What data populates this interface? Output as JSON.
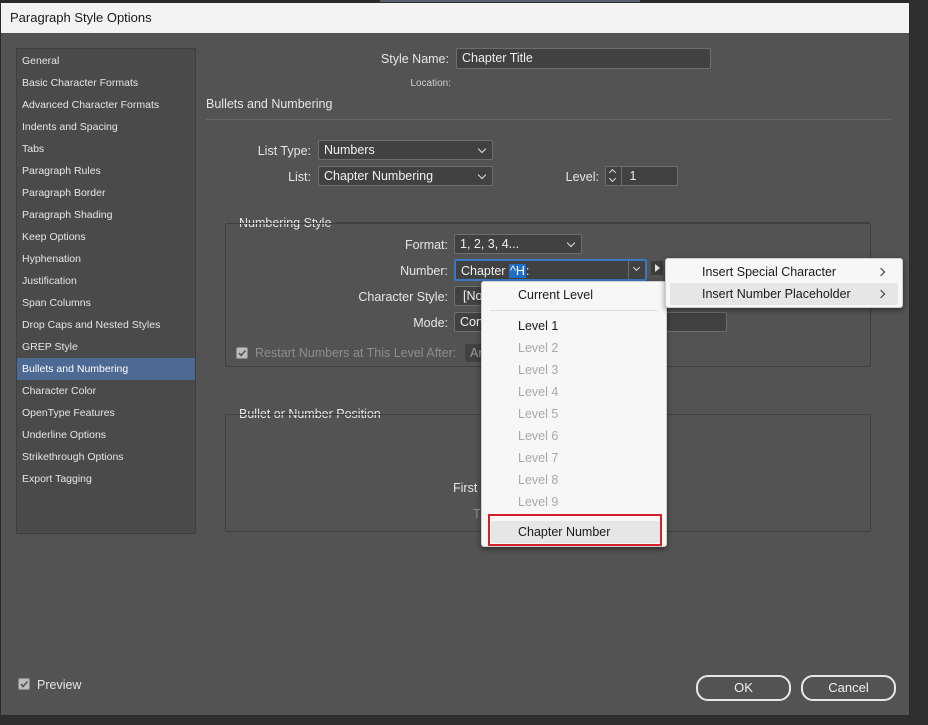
{
  "window": {
    "title": "Paragraph Style Options"
  },
  "categories": [
    {
      "label": "General"
    },
    {
      "label": "Basic Character Formats"
    },
    {
      "label": "Advanced Character Formats"
    },
    {
      "label": "Indents and Spacing"
    },
    {
      "label": "Tabs"
    },
    {
      "label": "Paragraph Rules"
    },
    {
      "label": "Paragraph Border"
    },
    {
      "label": "Paragraph Shading"
    },
    {
      "label": "Keep Options"
    },
    {
      "label": "Hyphenation"
    },
    {
      "label": "Justification"
    },
    {
      "label": "Span Columns"
    },
    {
      "label": "Drop Caps and Nested Styles"
    },
    {
      "label": "GREP Style"
    },
    {
      "label": "Bullets and Numbering",
      "selected": true
    },
    {
      "label": "Character Color"
    },
    {
      "label": "OpenType Features"
    },
    {
      "label": "Underline Options"
    },
    {
      "label": "Strikethrough Options"
    },
    {
      "label": "Export Tagging"
    }
  ],
  "header": {
    "style_name_label": "Style Name:",
    "style_name_value": "Chapter Title",
    "location_label": "Location:",
    "section_title": "Bullets and Numbering"
  },
  "list": {
    "list_type_label": "List Type:",
    "list_type_value": "Numbers",
    "list_label": "List:",
    "list_value": "Chapter Numbering",
    "level_label": "Level:",
    "level_value": "1"
  },
  "numbering_style": {
    "title": "Numbering Style",
    "format_label": "Format:",
    "format_value": "1, 2, 3, 4...",
    "number_label": "Number:",
    "number_value_prefix": "Chapter ",
    "number_value_selected": "^H",
    "number_value_suffix": ":",
    "char_style_label": "Character Style:",
    "char_style_value": "[No",
    "mode_label": "Mode:",
    "mode_value": "Cont",
    "restart_label": "Restart Numbers at This Level After:",
    "restart_value": "An"
  },
  "position": {
    "title": "Bullet or Number Position",
    "first_label_partial": "First",
    "tab_label_partial": "T"
  },
  "placeholder_menu": {
    "items": [
      {
        "label": "Current Level",
        "enabled": true
      },
      {
        "label": "Level 1",
        "enabled": true
      },
      {
        "label": "Level 2",
        "enabled": false
      },
      {
        "label": "Level 3",
        "enabled": false
      },
      {
        "label": "Level 4",
        "enabled": false
      },
      {
        "label": "Level 5",
        "enabled": false
      },
      {
        "label": "Level 6",
        "enabled": false
      },
      {
        "label": "Level 7",
        "enabled": false
      },
      {
        "label": "Level 8",
        "enabled": false
      },
      {
        "label": "Level 9",
        "enabled": false
      },
      {
        "label": "Chapter Number",
        "enabled": true,
        "highlighted": true
      }
    ]
  },
  "insert_menu": {
    "items": [
      {
        "label": "Insert Special Character"
      },
      {
        "label": "Insert Number Placeholder",
        "hovered": true
      }
    ]
  },
  "footer": {
    "preview_label": "Preview",
    "ok_label": "OK",
    "cancel_label": "Cancel"
  },
  "colors": {
    "selection": "#4c6a93",
    "text_highlight": "#1f6fc7",
    "callout_border": "#d3202a"
  }
}
